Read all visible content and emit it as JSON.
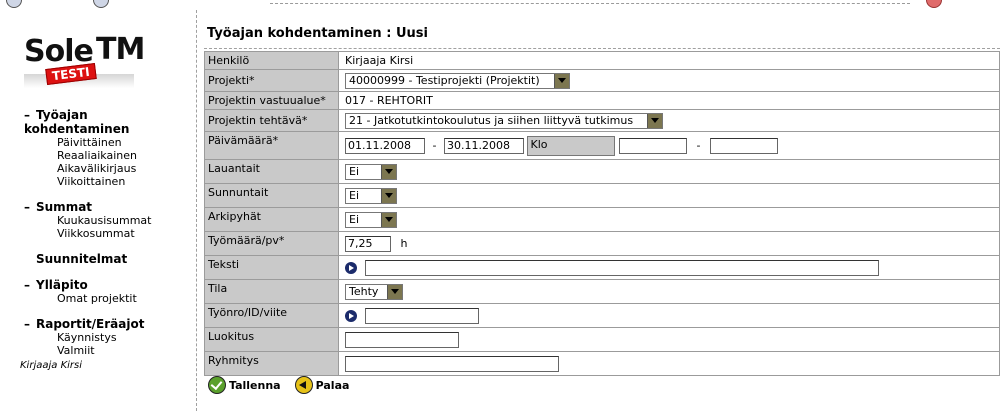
{
  "logo": {
    "sole": "Sole",
    "tm": "TM",
    "badge": "TESTI"
  },
  "nav": [
    {
      "label": "Työajan kohdentaminen",
      "items": [
        "Päivittäinen",
        "Reaaliaikainen",
        "Aikavälikirjaus",
        "Viikoittainen"
      ]
    },
    {
      "label": "Summat",
      "items": [
        "Kuukausisummat",
        "Viikkosummat"
      ]
    },
    {
      "label": "Suunnitelmat",
      "items": []
    },
    {
      "label": "Ylläpito",
      "items": [
        "Omat projektit"
      ]
    },
    {
      "label": "Raportit/Eräajot",
      "items": [
        "Käynnistys",
        "Valmiit"
      ]
    }
  ],
  "user": "Kirjaaja Kirsi",
  "page_title": "Työajan kohdentaminen : Uusi",
  "form": {
    "henkilo": {
      "label": "Henkilö",
      "value": "Kirjaaja Kirsi"
    },
    "projekti": {
      "label": "Projekti*",
      "value": "40000999 - Testiprojekti (Projektit)"
    },
    "vastuualue": {
      "label": "Projektin vastuualue*",
      "value": "017 - REHTORIT"
    },
    "tehtava": {
      "label": "Projektin tehtävä*",
      "value": "21 - Jatkotutkintokoulutus ja siihen liittyvä tutkimus"
    },
    "paivamaara": {
      "label": "Päivämäärä*",
      "from": "01.11.2008",
      "sep": "-",
      "to": "30.11.2008",
      "klo": "Klo",
      "time_from": "",
      "time_sep": "-",
      "time_to": ""
    },
    "lauantait": {
      "label": "Lauantait",
      "value": "Ei"
    },
    "sunnuntait": {
      "label": "Sunnuntait",
      "value": "Ei"
    },
    "arkipyhat": {
      "label": "Arkipyhät",
      "value": "Ei"
    },
    "tyomaara": {
      "label": "Työmäärä/pv*",
      "value": "7,25",
      "unit": "h"
    },
    "teksti": {
      "label": "Teksti",
      "value": ""
    },
    "tila": {
      "label": "Tila",
      "value": "Tehty"
    },
    "tyonro": {
      "label": "Työnro/ID/viite",
      "value": ""
    },
    "luokitus": {
      "label": "Luokitus",
      "value": ""
    },
    "ryhmitys": {
      "label": "Ryhmitys",
      "value": ""
    }
  },
  "actions": {
    "save": "Tallenna",
    "back": "Palaa"
  }
}
